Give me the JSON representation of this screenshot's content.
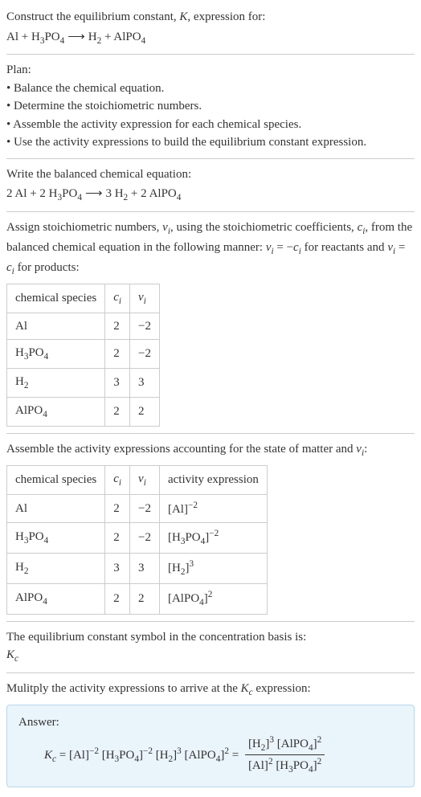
{
  "intro": {
    "line1_prefix": "Construct the equilibrium constant, ",
    "line1_K": "K",
    "line1_suffix": ", expression for:",
    "eq_lhs_1": "Al",
    "eq_plus": " + ",
    "eq_lhs_2": "H",
    "eq_lhs_2_sub": "3",
    "eq_lhs_3": "PO",
    "eq_lhs_3_sub": "4",
    "arrow": "⟶",
    "eq_rhs_1": "H",
    "eq_rhs_1_sub": "2",
    "eq_rhs_2": "AlPO",
    "eq_rhs_2_sub": "4"
  },
  "plan": {
    "title": "Plan:",
    "b1": "• Balance the chemical equation.",
    "b2": "• Determine the stoichiometric numbers.",
    "b3": "• Assemble the activity expression for each chemical species.",
    "b4": "• Use the activity expressions to build the equilibrium constant expression."
  },
  "balanced": {
    "title": "Write the balanced chemical equation:",
    "c1": "2 Al",
    "c2": "2 H",
    "c2_sub": "3",
    "c2b": "PO",
    "c2b_sub": "4",
    "arrow": "⟶",
    "c3": "3 H",
    "c3_sub": "2",
    "c4": "2 AlPO",
    "c4_sub": "4"
  },
  "assign": {
    "text1": "Assign stoichiometric numbers, ",
    "nu": "ν",
    "sub_i": "i",
    "text2": ", using the stoichiometric coefficients, ",
    "c": "c",
    "text3": ", from the balanced chemical equation in the following manner: ",
    "eq1_lhs": "ν",
    "eq1_eq": " = −",
    "eq1_rhs": "c",
    "text4": " for reactants and ",
    "eq2": " = ",
    "text5": " for products:"
  },
  "table1": {
    "h1": "chemical species",
    "h2": "c",
    "h2_sub": "i",
    "h3": "ν",
    "h3_sub": "i",
    "rows": [
      {
        "sp": "Al",
        "sp_sub": "",
        "sp2": "",
        "sp2_sub": "",
        "c": "2",
        "v": "−2"
      },
      {
        "sp": "H",
        "sp_sub": "3",
        "sp2": "PO",
        "sp2_sub": "4",
        "c": "2",
        "v": "−2"
      },
      {
        "sp": "H",
        "sp_sub": "2",
        "sp2": "",
        "sp2_sub": "",
        "c": "3",
        "v": "3"
      },
      {
        "sp": "AlPO",
        "sp_sub": "4",
        "sp2": "",
        "sp2_sub": "",
        "c": "2",
        "v": "2"
      }
    ]
  },
  "assemble": {
    "text1": "Assemble the activity expressions accounting for the state of matter and ",
    "nu": "ν",
    "sub_i": "i",
    "text2": ":"
  },
  "table2": {
    "h1": "chemical species",
    "h2": "c",
    "h2_sub": "i",
    "h3": "ν",
    "h3_sub": "i",
    "h4": "activity expression",
    "rows": [
      {
        "sp": "Al",
        "sp_sub": "",
        "sp2": "",
        "sp2_sub": "",
        "c": "2",
        "v": "−2",
        "a_pre": "[Al]",
        "a_exp": "−2"
      },
      {
        "sp": "H",
        "sp_sub": "3",
        "sp2": "PO",
        "sp2_sub": "4",
        "c": "2",
        "v": "−2",
        "a_pre": "[H",
        "a_sub1": "3",
        "a_mid": "PO",
        "a_sub2": "4",
        "a_post": "]",
        "a_exp": "−2"
      },
      {
        "sp": "H",
        "sp_sub": "2",
        "sp2": "",
        "sp2_sub": "",
        "c": "3",
        "v": "3",
        "a_pre": "[H",
        "a_sub1": "2",
        "a_post": "]",
        "a_exp": "3"
      },
      {
        "sp": "AlPO",
        "sp_sub": "4",
        "sp2": "",
        "sp2_sub": "",
        "c": "2",
        "v": "2",
        "a_pre": "[AlPO",
        "a_sub1": "4",
        "a_post": "]",
        "a_exp": "2"
      }
    ]
  },
  "eqsymbol": {
    "text": "The equilibrium constant symbol in the concentration basis is:",
    "K": "K",
    "Ksub": "c"
  },
  "multiply": {
    "text1": "Mulitply the activity expressions to arrive at the ",
    "K": "K",
    "Ksub": "c",
    "text2": " expression:"
  },
  "answer": {
    "label": "Answer:",
    "K": "K",
    "Ksub": "c",
    "eq": " = ",
    "t1": "[Al]",
    "t1_exp": "−2",
    "sp": " ",
    "t2a": "[H",
    "t2a_sub": "3",
    "t2b": "PO",
    "t2b_sub": "4",
    "t2c": "]",
    "t2_exp": "−2",
    "t3a": "[H",
    "t3a_sub": "2",
    "t3b": "]",
    "t3_exp": "3",
    "t4a": "[AlPO",
    "t4a_sub": "4",
    "t4b": "]",
    "t4_exp": "2",
    "num1a": "[H",
    "num1a_sub": "2",
    "num1b": "]",
    "num1_exp": "3",
    "num2a": "[AlPO",
    "num2a_sub": "4",
    "num2b": "]",
    "num2_exp": "2",
    "den1": "[Al]",
    "den1_exp": "2",
    "den2a": "[H",
    "den2a_sub": "3",
    "den2b": "PO",
    "den2b_sub": "4",
    "den2c": "]",
    "den2_exp": "2"
  }
}
